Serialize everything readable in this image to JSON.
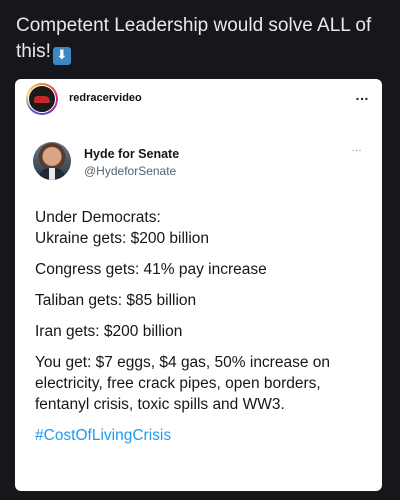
{
  "caption": {
    "text": "Competent Leadership would solve ALL of this!",
    "emoji": "⬇",
    "emoji_icon": "down-arrow-emoji-icon"
  },
  "instagram": {
    "username": "redracervideo",
    "more_icon": "…"
  },
  "tweet": {
    "name": "Hyde for Senate",
    "handle": "@HydeforSenate",
    "more_icon": "…",
    "lines": [
      "Under Democrats:",
      "Ukraine gets: $200 billion",
      "Congress gets: 41% pay increase",
      "Taliban gets: $85 billion",
      "Iran gets: $200 billion",
      "You get: $7 eggs, $4 gas, 50% increase on electricity, free crack pipes, open borders, fentanyl crisis, toxic spills and WW3."
    ],
    "hashtag": "#CostOfLivingCrisis"
  },
  "colors": {
    "background": "#15171c",
    "link": "#1d9bf0"
  }
}
